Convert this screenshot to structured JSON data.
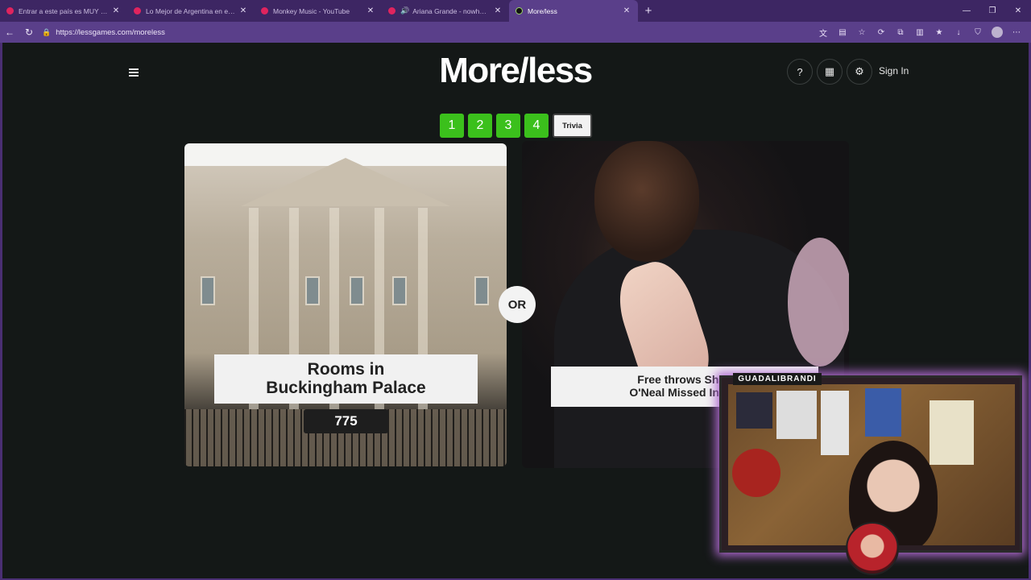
{
  "browser": {
    "tabs": [
      {
        "title": "Entrar a este país es MUY difícil y...",
        "color": "#e0245e",
        "active": false
      },
      {
        "title": "Lo Mejor de Argentina en el Mundo",
        "color": "#e0245e",
        "active": false
      },
      {
        "title": "Monkey Music - YouTube",
        "color": "#e0245e",
        "active": false
      },
      {
        "title": "Ariana Grande - nowhere, nobody",
        "color": "#e0245e",
        "active": false
      },
      {
        "title": "More/less",
        "color": "#1a1a1a",
        "active": true
      }
    ],
    "url": "https://lessgames.com/moreless",
    "new_tab": "+"
  },
  "app": {
    "logo": "More/less",
    "help_icon": "?",
    "sign_in": "Sign In",
    "levels": [
      "1",
      "2",
      "3",
      "4"
    ],
    "trivia": "Trivia"
  },
  "left_card": {
    "label_line1": "Rooms in",
    "label_line2": "Buckingham Palace",
    "value": "775"
  },
  "or_badge": "OR",
  "right_card": {
    "label_line1": "Free throws Shaq",
    "label_line2": "O'Neal Missed In His"
  },
  "stream_overlay": {
    "name": "GUADALIBRANDI"
  },
  "colors": {
    "accent_green": "#3bc01c",
    "page_bg": "#141817",
    "browser_purple": "#5a3f8a"
  }
}
